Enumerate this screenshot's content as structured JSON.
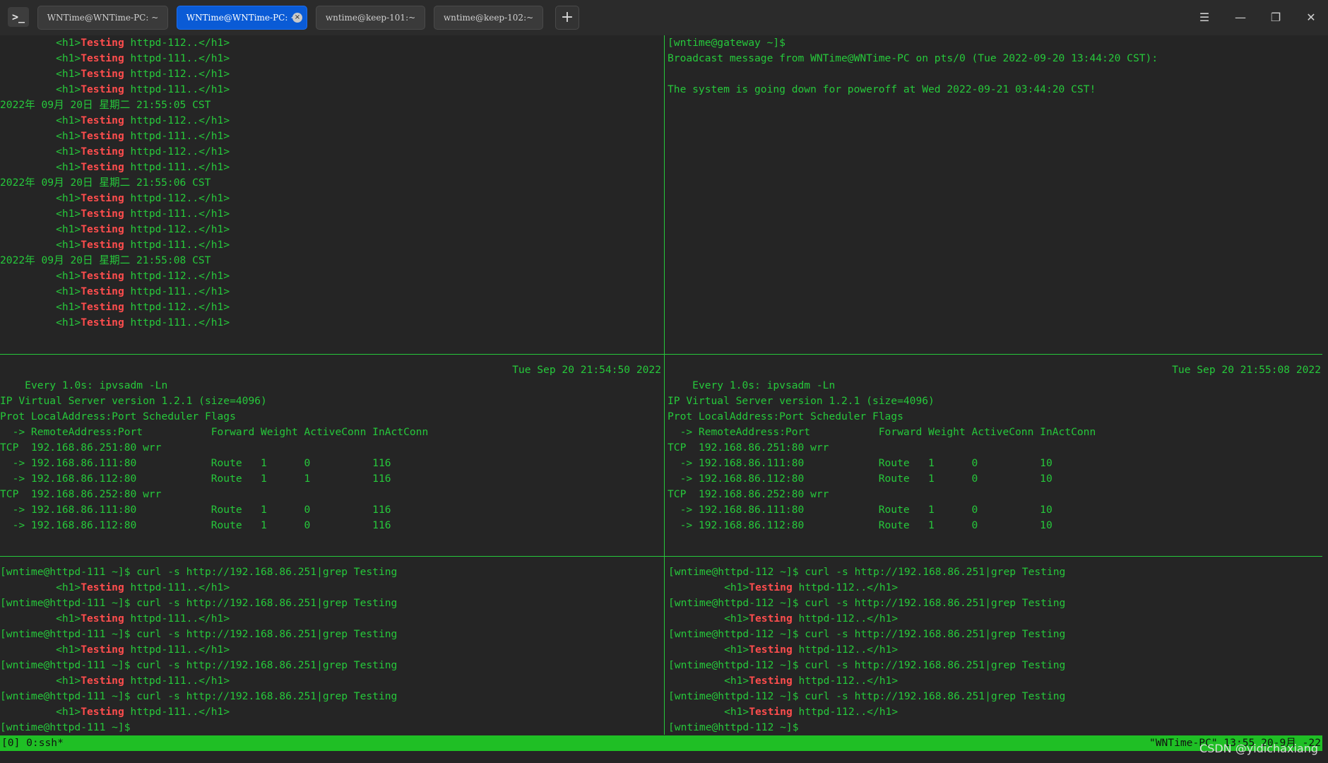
{
  "window": {
    "app_icon": ">_",
    "tabs": [
      {
        "label": "WNTime@WNTime-PC: ~",
        "active": false
      },
      {
        "label": "WNTime@WNTime-PC: ~",
        "active": true,
        "close": "×"
      },
      {
        "label": "wntime@keep-101:~",
        "active": false
      },
      {
        "label": "wntime@keep-102:~",
        "active": false
      }
    ],
    "add_tab": "+",
    "controls": {
      "menu": "☰",
      "minimize": "—",
      "maximize": "❐",
      "close": "✕"
    }
  },
  "colors": {
    "accent_tab": "#0a5bd6",
    "term_green": "#26c93b",
    "keyword_red": "#ff4d4d",
    "status_bar": "#1fbf25"
  },
  "panes": {
    "top_left": {
      "lines": [
        {
          "pre": "         <h1>",
          "kw": "Testing",
          "post": " httpd-112..</h1>"
        },
        {
          "pre": "         <h1>",
          "kw": "Testing",
          "post": " httpd-111..</h1>"
        },
        {
          "pre": "         <h1>",
          "kw": "Testing",
          "post": " httpd-112..</h1>"
        },
        {
          "pre": "         <h1>",
          "kw": "Testing",
          "post": " httpd-111..</h1>"
        },
        {
          "pre": "2022年 09月 20日 星期二 21:55:05 CST"
        },
        {
          "pre": "         <h1>",
          "kw": "Testing",
          "post": " httpd-112..</h1>"
        },
        {
          "pre": "         <h1>",
          "kw": "Testing",
          "post": " httpd-111..</h1>"
        },
        {
          "pre": "         <h1>",
          "kw": "Testing",
          "post": " httpd-112..</h1>"
        },
        {
          "pre": "         <h1>",
          "kw": "Testing",
          "post": " httpd-111..</h1>"
        },
        {
          "pre": "2022年 09月 20日 星期二 21:55:06 CST"
        },
        {
          "pre": "         <h1>",
          "kw": "Testing",
          "post": " httpd-112..</h1>"
        },
        {
          "pre": "         <h1>",
          "kw": "Testing",
          "post": " httpd-111..</h1>"
        },
        {
          "pre": "         <h1>",
          "kw": "Testing",
          "post": " httpd-112..</h1>"
        },
        {
          "pre": "         <h1>",
          "kw": "Testing",
          "post": " httpd-111..</h1>"
        },
        {
          "pre": "2022年 09月 20日 星期二 21:55:08 CST"
        },
        {
          "pre": "         <h1>",
          "kw": "Testing",
          "post": " httpd-112..</h1>"
        },
        {
          "pre": "         <h1>",
          "kw": "Testing",
          "post": " httpd-111..</h1>"
        },
        {
          "pre": "         <h1>",
          "kw": "Testing",
          "post": " httpd-112..</h1>"
        },
        {
          "pre": "         <h1>",
          "kw": "Testing",
          "post": " httpd-111..</h1>"
        }
      ]
    },
    "top_right": {
      "lines": [
        {
          "pre": "[wntime@gateway ~]$"
        },
        {
          "pre": "Broadcast message from WNTime@WNTime-PC on pts/0 (Tue 2022-09-20 13:44:20 CST):"
        },
        {
          "pre": ""
        },
        {
          "pre": "The system is going down for poweroff at Wed 2022-09-21 03:44:20 CST!"
        }
      ]
    },
    "mid_left": {
      "header_left": "Every 1.0s: ipvsadm -Ln",
      "header_right": "Tue Sep 20 21:54:50 2022",
      "lines": [
        {
          "pre": ""
        },
        {
          "pre": "IP Virtual Server version 1.2.1 (size=4096)"
        },
        {
          "pre": "Prot LocalAddress:Port Scheduler Flags"
        },
        {
          "pre": "  -> RemoteAddress:Port           Forward Weight ActiveConn InActConn"
        },
        {
          "pre": "TCP  192.168.86.251:80 wrr"
        },
        {
          "pre": "  -> 192.168.86.111:80            Route   1      0          116"
        },
        {
          "pre": "  -> 192.168.86.112:80            Route   1      1          116"
        },
        {
          "pre": "TCP  192.168.86.252:80 wrr"
        },
        {
          "pre": "  -> 192.168.86.111:80            Route   1      0          116"
        },
        {
          "pre": "  -> 192.168.86.112:80            Route   1      0          116"
        }
      ]
    },
    "mid_right": {
      "header_left": "Every 1.0s: ipvsadm -Ln",
      "header_right": "Tue Sep 20 21:55:08 2022",
      "lines": [
        {
          "pre": ""
        },
        {
          "pre": "IP Virtual Server version 1.2.1 (size=4096)"
        },
        {
          "pre": "Prot LocalAddress:Port Scheduler Flags"
        },
        {
          "pre": "  -> RemoteAddress:Port           Forward Weight ActiveConn InActConn"
        },
        {
          "pre": "TCP  192.168.86.251:80 wrr"
        },
        {
          "pre": "  -> 192.168.86.111:80            Route   1      0          10"
        },
        {
          "pre": "  -> 192.168.86.112:80            Route   1      0          10"
        },
        {
          "pre": "TCP  192.168.86.252:80 wrr"
        },
        {
          "pre": "  -> 192.168.86.111:80            Route   1      0          10"
        },
        {
          "pre": "  -> 192.168.86.112:80            Route   1      0          10"
        }
      ]
    },
    "bottom_left": {
      "lines": [
        {
          "pre": "[wntime@httpd-111 ~]$ curl -s http://192.168.86.251|grep Testing"
        },
        {
          "pre": "         <h1>",
          "kw": "Testing",
          "post": " httpd-111..</h1>"
        },
        {
          "pre": "[wntime@httpd-111 ~]$ curl -s http://192.168.86.251|grep Testing"
        },
        {
          "pre": "         <h1>",
          "kw": "Testing",
          "post": " httpd-111..</h1>"
        },
        {
          "pre": "[wntime@httpd-111 ~]$ curl -s http://192.168.86.251|grep Testing"
        },
        {
          "pre": "         <h1>",
          "kw": "Testing",
          "post": " httpd-111..</h1>"
        },
        {
          "pre": "[wntime@httpd-111 ~]$ curl -s http://192.168.86.251|grep Testing"
        },
        {
          "pre": "         <h1>",
          "kw": "Testing",
          "post": " httpd-111..</h1>"
        },
        {
          "pre": "[wntime@httpd-111 ~]$ curl -s http://192.168.86.251|grep Testing"
        },
        {
          "pre": "         <h1>",
          "kw": "Testing",
          "post": " httpd-111..</h1>"
        },
        {
          "pre": "[wntime@httpd-111 ~]$"
        }
      ]
    },
    "bottom_right": {
      "lines": [
        {
          "pre": "[wntime@httpd-112 ~]$ curl -s http://192.168.86.251|grep Testing"
        },
        {
          "pre": "         <h1>",
          "kw": "Testing",
          "post": " httpd-112..</h1>"
        },
        {
          "pre": "[wntime@httpd-112 ~]$ curl -s http://192.168.86.251|grep Testing"
        },
        {
          "pre": "         <h1>",
          "kw": "Testing",
          "post": " httpd-112..</h1>"
        },
        {
          "pre": "[wntime@httpd-112 ~]$ curl -s http://192.168.86.251|grep Testing"
        },
        {
          "pre": "         <h1>",
          "kw": "Testing",
          "post": " httpd-112..</h1>"
        },
        {
          "pre": "[wntime@httpd-112 ~]$ curl -s http://192.168.86.251|grep Testing"
        },
        {
          "pre": "         <h1>",
          "kw": "Testing",
          "post": " httpd-112..</h1>"
        },
        {
          "pre": "[wntime@httpd-112 ~]$ curl -s http://192.168.86.251|grep Testing"
        },
        {
          "pre": "         <h1>",
          "kw": "Testing",
          "post": " httpd-112..</h1>"
        },
        {
          "pre": "[wntime@httpd-112 ~]$"
        }
      ]
    }
  },
  "statusbar": {
    "left": "[0] 0:ssh*",
    "right": "\"WNTime-PC\" 13:55 20-9月 -22"
  },
  "watermark": "CSDN @yidichaxiang"
}
